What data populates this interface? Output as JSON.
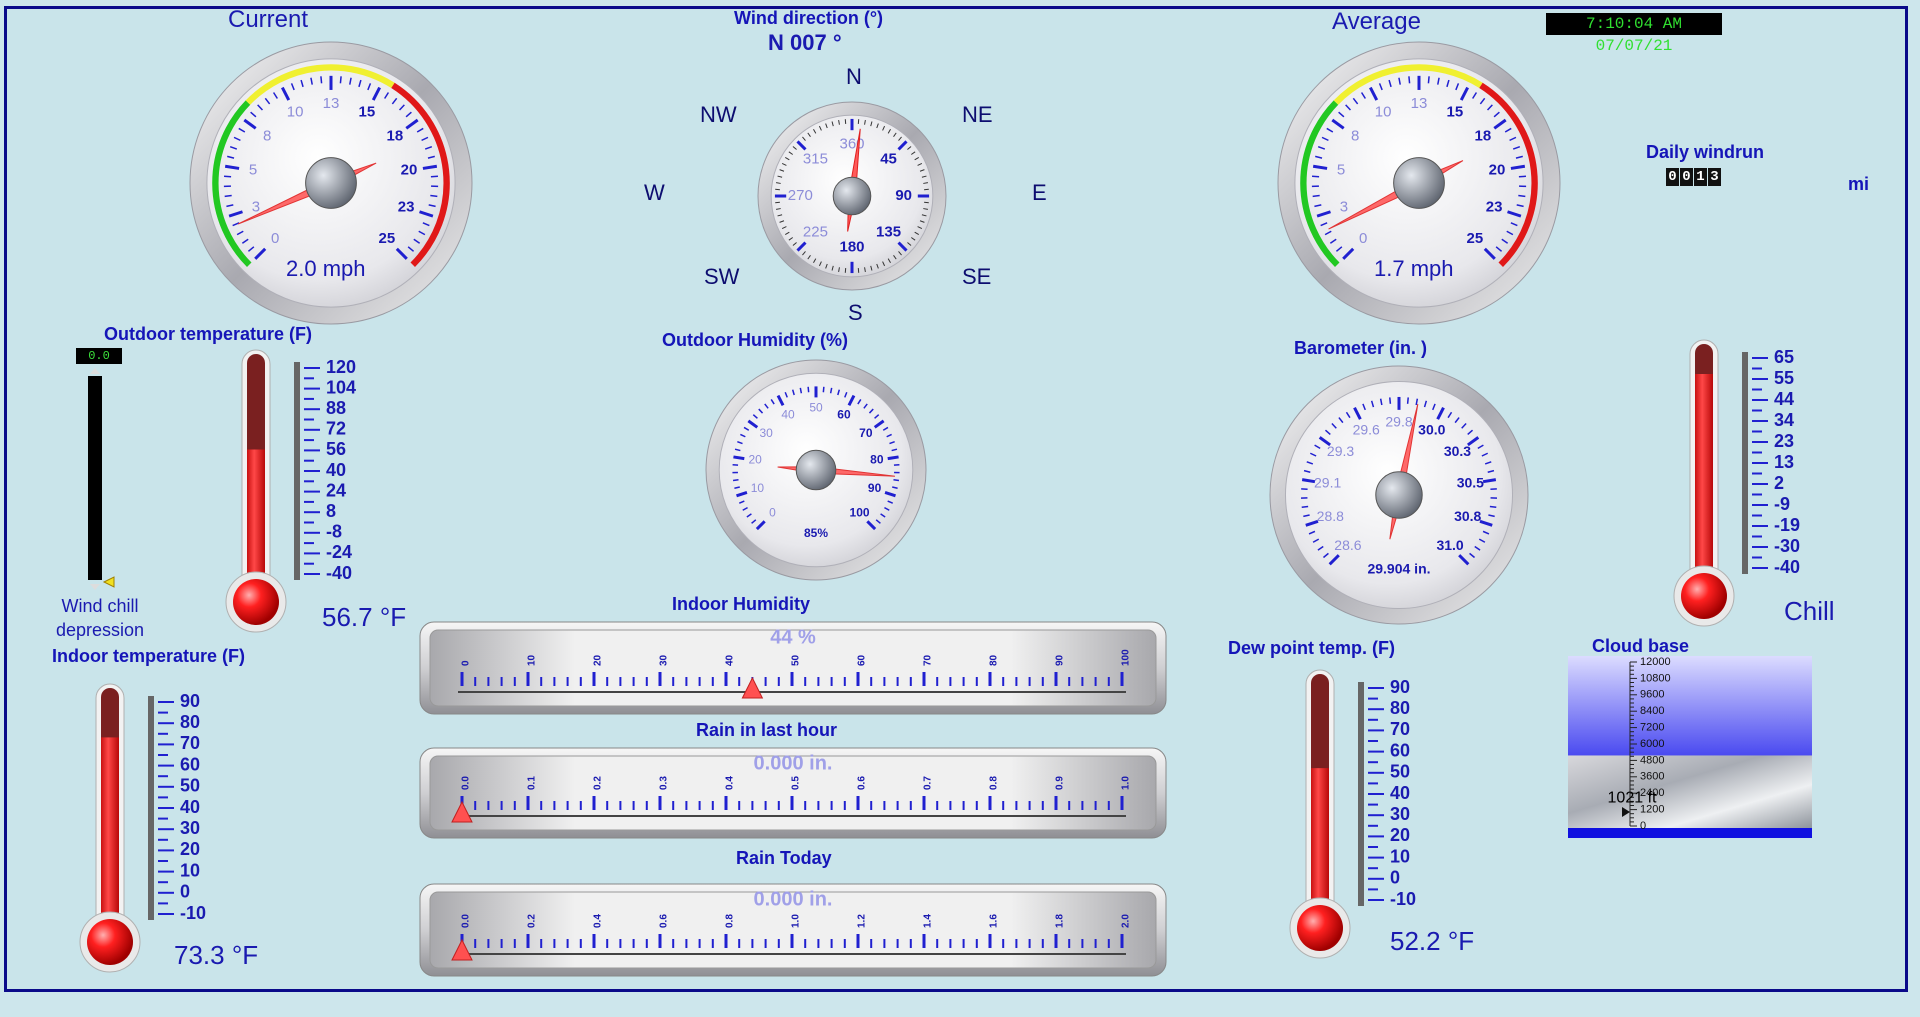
{
  "clock": "7:10:04 AM 07/07/21",
  "wind_current": {
    "title": "Current",
    "readout": "2.0 mph",
    "value": 2.0,
    "ticks": [
      "0",
      "3",
      "5",
      "8",
      "10",
      "13",
      "15",
      "18",
      "20",
      "23",
      "25"
    ]
  },
  "wind_average": {
    "title": "Average",
    "readout": "1.7 mph",
    "value": 1.7,
    "ticks": [
      "0",
      "3",
      "5",
      "8",
      "10",
      "13",
      "15",
      "18",
      "20",
      "23",
      "25"
    ]
  },
  "wind_direction": {
    "title": "Wind direction (°)",
    "readout": "N  007 °",
    "degrees": 7,
    "compass": {
      "n": "N",
      "ne": "NE",
      "e": "E",
      "se": "SE",
      "s": "S",
      "sw": "SW",
      "w": "W",
      "nw": "NW"
    },
    "dial_labels": [
      "45",
      "90",
      "135",
      "180",
      "225",
      "270",
      "315",
      "360"
    ]
  },
  "windrun": {
    "title": "Daily windrun",
    "digits": [
      "0",
      "0",
      "1",
      "3"
    ],
    "unit": "mi"
  },
  "wind_chill_depression": {
    "label": "Wind chill\ndepression",
    "readout": "0.0",
    "level": 0.0
  },
  "outdoor_temp": {
    "title": "Outdoor temperature (F)",
    "readout": "56.7 °F",
    "value": 56.7,
    "scale": [
      "120",
      "104",
      "88",
      "72",
      "56",
      "40",
      "24",
      "8",
      "-8",
      "-24",
      "-40"
    ]
  },
  "indoor_temp": {
    "title": "Indoor temperature (F)",
    "readout": "73.3 °F",
    "value": 73.3,
    "scale": [
      "90",
      "80",
      "70",
      "60",
      "50",
      "40",
      "30",
      "20",
      "10",
      "0",
      "-10"
    ]
  },
  "dew_point": {
    "title": "Dew point temp. (F)",
    "readout": "52.2 °F",
    "value": 52.2,
    "scale": [
      "90",
      "80",
      "70",
      "60",
      "50",
      "40",
      "30",
      "20",
      "10",
      "0",
      "-10"
    ]
  },
  "chill": {
    "title": "Chill",
    "scale": [
      "65",
      "55",
      "44",
      "34",
      "23",
      "13",
      "2",
      "-9",
      "-19",
      "-30",
      "-40"
    ]
  },
  "outdoor_humidity": {
    "title": "Outdoor Humidity (%)",
    "readout": "85%",
    "value": 85,
    "ticks": [
      "0",
      "10",
      "20",
      "30",
      "40",
      "50",
      "60",
      "70",
      "80",
      "90",
      "100"
    ]
  },
  "barometer": {
    "title": "Barometer (in. )",
    "readout": "29.904 in.",
    "value": 29.904,
    "ticks": [
      "28.6",
      "28.8",
      "29.1",
      "29.3",
      "29.6",
      "29.8",
      "30.0",
      "30.3",
      "30.5",
      "30.8",
      "31.0"
    ]
  },
  "indoor_humidity": {
    "title": "Indoor Humidity",
    "readout": "44 %",
    "value": 44,
    "ticks": [
      "0",
      "10",
      "20",
      "30",
      "40",
      "50",
      "60",
      "70",
      "80",
      "90",
      "100"
    ]
  },
  "rain_hour": {
    "title": "Rain in last hour",
    "readout": "0.000 in.",
    "value": 0.0,
    "ticks": [
      "0.0",
      "0.1",
      "0.2",
      "0.3",
      "0.4",
      "0.5",
      "0.6",
      "0.7",
      "0.8",
      "0.9",
      "1.0"
    ]
  },
  "rain_today": {
    "title": "Rain Today",
    "readout": "0.000 in.",
    "value": 0.0,
    "ticks": [
      "0.0",
      "0.2",
      "0.4",
      "0.6",
      "0.8",
      "1.0",
      "1.2",
      "1.4",
      "1.6",
      "1.8",
      "2.0"
    ]
  },
  "cloud_base": {
    "title": "Cloud base",
    "readout": "1021 ft",
    "value": 1021,
    "scale": [
      "12000",
      "10800",
      "9600",
      "8400",
      "7200",
      "6000",
      "4800",
      "3600",
      "2400",
      "1200",
      "0"
    ]
  }
}
